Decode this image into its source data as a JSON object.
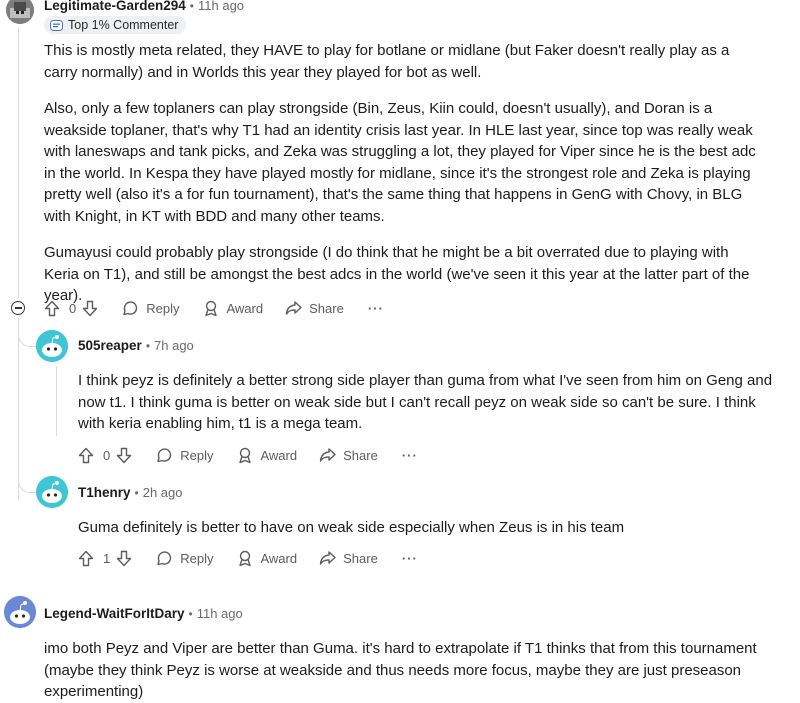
{
  "comments": [
    {
      "username": "Legitimate-Garden294",
      "time": "11h ago",
      "flair": "Top 1% Commenter",
      "paragraphs": [
        "This is mostly meta related, they HAVE to play for botlane or midlane (but Faker doesn't really play as a carry normally) and in Worlds this year they played for bot  as well.",
        "Also, only a few toplaners can play strongside (Bin, Zeus, Kiin could, doesn't usually), and Doran is a weakside toplaner, that's why T1 had an identity crisis last year.  In HLE last year, since top was really weak with laneswaps and tank picks, and Zeka was struggling a lot, they played for Viper since he is the best adc in the world. In Kespa they have played mostly for midlane, since it's the strongest role and Zeka is playing pretty well (also it's a for fun tournament), that's the same thing that happens in GenG with Chovy, in BLG with Knight, in KT with BDD and many other teams.",
        "Gumayusi could probably play strongside (I do think that he might be a bit overrated due to playing with Keria on T1), and still be amongst the best adcs in the world (we've seen it this year at the latter part of the year)."
      ],
      "votes": "0"
    },
    {
      "username": "505reaper",
      "time": "7h ago",
      "paragraphs": [
        "I think peyz is definitely a better strong side player than guma from what I've seen from him on Geng and now t1. I think guma is better on weak side but I can't recall peyz on weak side so can't be sure. I think with keria enabling him, t1 is a mega team."
      ],
      "votes": "0"
    },
    {
      "username": "T1henry",
      "time": "2h ago",
      "paragraphs": [
        "Guma definitely is better to have on weak side especially when Zeus is in his team"
      ],
      "votes": "1"
    },
    {
      "username": "Legend-WaitForItDary",
      "time": "11h ago",
      "paragraphs": [
        "imo both Peyz and Viper are better than Guma. it's hard to extrapolate if T1 thinks that from this tournament (maybe they think Peyz is worse at weakside and thus needs more focus, maybe they are just preseason experimenting)"
      ]
    }
  ],
  "actions": {
    "reply": "Reply",
    "award": "Award",
    "share": "Share",
    "more": "···"
  },
  "separator": "•",
  "icons": [
    "upvote-icon",
    "downvote-icon",
    "reply-icon",
    "award-icon",
    "share-icon",
    "more-icon",
    "collapse-icon",
    "flair-icon",
    "avatar"
  ],
  "colors": {
    "text": "#1c1c1c",
    "meta": "#6a6a6a",
    "avatar_teal": "#3ec6d6",
    "avatar_blue": "#6b88d6",
    "thread_line": "#dcdcdc"
  }
}
